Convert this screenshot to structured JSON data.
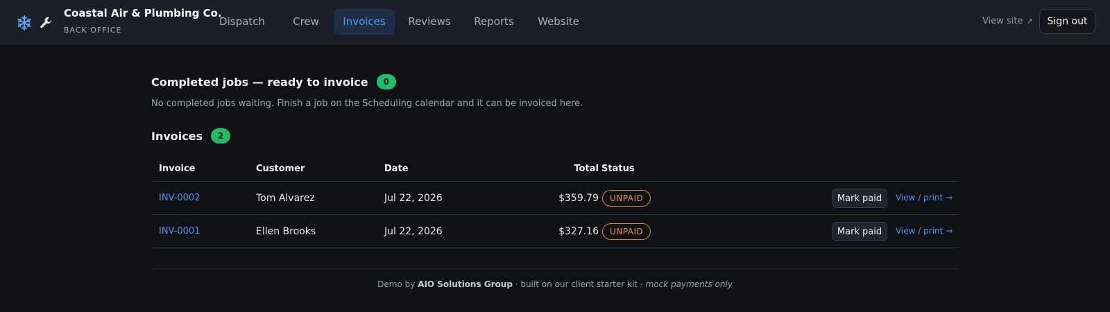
{
  "header": {
    "brand_name": "Coastal Air & Plumbing Co.",
    "brand_sub": "BACK OFFICE",
    "icons": [
      "snowflake-icon",
      "wrench-icon"
    ],
    "nav": [
      {
        "label": "Dispatch",
        "active": false
      },
      {
        "label": "Crew",
        "active": false
      },
      {
        "label": "Invoices",
        "active": true
      },
      {
        "label": "Reviews",
        "active": false
      },
      {
        "label": "Reports",
        "active": false
      },
      {
        "label": "Website",
        "active": false
      }
    ],
    "view_site": "View site",
    "view_site_icon": "↗",
    "sign_out": "Sign out"
  },
  "completed": {
    "title": "Completed jobs — ready to invoice",
    "count": "0",
    "empty_text": "No completed jobs waiting. Finish a job on the Scheduling calendar and it can be invoiced here."
  },
  "invoices": {
    "title": "Invoices",
    "count": "2",
    "columns": {
      "invoice": "Invoice",
      "customer": "Customer",
      "date": "Date",
      "total": "Total",
      "status": "Status"
    },
    "rows": [
      {
        "id": "INV-0002",
        "customer": "Tom Alvarez",
        "date": "Jul 22, 2026",
        "total": "$359.79",
        "status": "UNPAID",
        "action": "Mark paid",
        "link": "View / print →"
      },
      {
        "id": "INV-0001",
        "customer": "Ellen Brooks",
        "date": "Jul 22, 2026",
        "total": "$327.16",
        "status": "UNPAID",
        "action": "Mark paid",
        "link": "View / print →"
      }
    ]
  },
  "footer": {
    "prefix": "Demo by",
    "company": "AIO Solutions Group",
    "middle": "· built on our client starter kit ·",
    "note": "mock payments only"
  },
  "colors": {
    "accent": "#4f95f0",
    "badge": "#1fbf6a",
    "unpaid": "#d38a3c",
    "background": "#101114",
    "header": "#1b1e26"
  }
}
